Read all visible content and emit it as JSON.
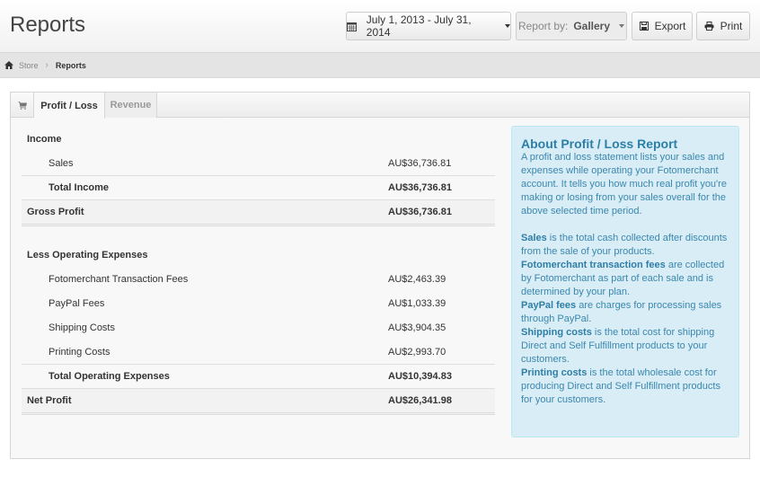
{
  "header": {
    "title": "Reports",
    "date_range_label": "July 1, 2013 - July 31, 2014",
    "date_icon": "calendar-icon",
    "report_by_prefix": "Report by:",
    "report_by_value": "Gallery",
    "export_label": "Export",
    "export_icon": "floppy-disk-icon",
    "print_label": "Print",
    "print_icon": "printer-icon"
  },
  "breadcrumb": {
    "home_icon": "home-icon",
    "items": [
      "Store",
      "Reports"
    ]
  },
  "tabs": {
    "icon": "cart-icon",
    "items": [
      {
        "label": "Profit / Loss",
        "active": true
      },
      {
        "label": "Revenue",
        "active": false
      }
    ]
  },
  "report": {
    "income_heading": "Income",
    "income_items": [
      {
        "label": "Sales",
        "amount": "AU$36,736.81"
      }
    ],
    "total_income": {
      "label": "Total Income",
      "amount": "AU$36,736.81"
    },
    "gross_profit": {
      "label": "Gross Profit",
      "amount": "AU$36,736.81"
    },
    "expenses_heading": "Less Operating Expenses",
    "expense_items": [
      {
        "label": "Fotomerchant Transaction Fees",
        "amount": "AU$2,463.39"
      },
      {
        "label": "PayPal Fees",
        "amount": "AU$1,033.39"
      },
      {
        "label": "Shipping Costs",
        "amount": "AU$3,904.35"
      },
      {
        "label": "Printing Costs",
        "amount": "AU$2,993.70"
      }
    ],
    "total_expenses": {
      "label": "Total Operating Expenses",
      "amount": "AU$10,394.83"
    },
    "net_profit": {
      "label": "Net Profit",
      "amount": "AU$26,341.98"
    }
  },
  "info": {
    "title": "About Profit / Loss Report",
    "intro": "A profit and loss statement lists your sales and expenses while operating your Fotomerchant account. It tells you how much real profit you're making or losing from your sales overall for the above selected time period.",
    "definitions": [
      {
        "term": "Sales",
        "text": " is the total cash collected after discounts from the sale of your products."
      },
      {
        "term": "Fotomerchant transaction fees",
        "text": " are collected by Fotomerchant as part of each sale and is determined by your plan."
      },
      {
        "term": "PayPal fees",
        "text": " are charges for processing sales through PayPal."
      },
      {
        "term": "Shipping costs",
        "text": " is the total cost for shipping Direct and Self Fulfillment products to your customers."
      },
      {
        "term": "Printing costs",
        "text": " is the total wholesale cost for producing Direct and Self Fulfillment products for your customers."
      }
    ]
  }
}
